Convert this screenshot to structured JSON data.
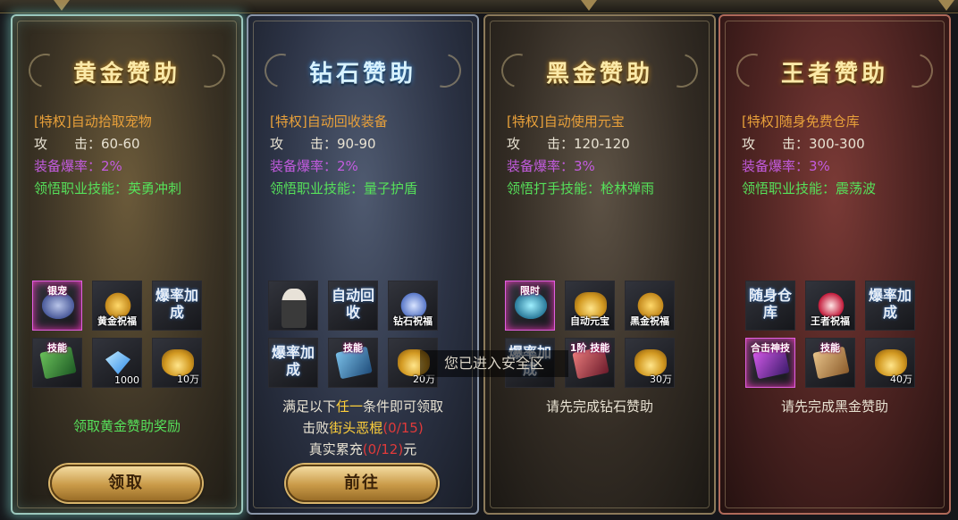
{
  "cards": [
    {
      "title": "黄金赞助",
      "privilege": "[特权]自动拾取宠物",
      "attack": "攻　　击：60-60",
      "drop_rate": "装备爆率：2%",
      "skill": "领悟职业技能：英勇冲刺",
      "rewards": [
        {
          "icon": "pet-icon",
          "label": "银宠"
        },
        {
          "icon": "gold-emblem-icon",
          "label": "黄金祝福"
        },
        {
          "icon": "drop-rate-icon",
          "label": "爆率加成"
        },
        {
          "icon": "skill-book-icon",
          "label": "技能"
        },
        {
          "icon": "diamond-icon",
          "count": "1000"
        },
        {
          "icon": "gold-ingot-icon",
          "count": "10万"
        }
      ],
      "status": "领取黄金赞助奖励",
      "button": "领取"
    },
    {
      "title": "钻石赞助",
      "privilege": "[特权]自动回收装备",
      "attack": "攻　　击：90-90",
      "drop_rate": "装备爆率：2%",
      "skill": "领悟职业技能：量子护盾",
      "rewards": [
        {
          "icon": "officer-avatar-icon",
          "label": ""
        },
        {
          "icon": "auto-recycle-icon",
          "label": "自动回收"
        },
        {
          "icon": "diamond-emblem-icon",
          "label": "钻石祝福"
        },
        {
          "icon": "drop-rate-icon",
          "label": "爆率加成"
        },
        {
          "icon": "skill-book-icon",
          "label": "技能"
        },
        {
          "icon": "gold-ingot-icon",
          "count": "20万"
        }
      ],
      "condition_intro": "满足以下任一条件即可领取",
      "condition_intro_parts": [
        "满足以下",
        "任一",
        "条件即可领取"
      ],
      "condition_1": {
        "prefix": "击败",
        "target": "街头恶棍",
        "progress": "(0/15)"
      },
      "condition_2": {
        "prefix": "真实累充",
        "progress": "(0/12)",
        "suffix": "元"
      },
      "button": "前往"
    },
    {
      "title": "黑金赞助",
      "privilege": "[特权]自动使用元宝",
      "attack": "攻　　击：120-120",
      "drop_rate": "装备爆率：3%",
      "skill": "领悟打手技能：枪林弹雨",
      "rewards": [
        {
          "icon": "weapon-icon",
          "label": "限时"
        },
        {
          "icon": "auto-ingot-icon",
          "label": "自动元宝"
        },
        {
          "icon": "black-gold-emblem-icon",
          "label": "黑金祝福"
        },
        {
          "icon": "drop-rate-icon",
          "label": "爆率加成"
        },
        {
          "icon": "skill-book-icon",
          "label": "1阶 技能"
        },
        {
          "icon": "gold-ingot-icon",
          "count": "30万"
        }
      ],
      "status": "请先完成钻石赞助"
    },
    {
      "title": "王者赞助",
      "privilege": "[特权]随身免费仓库",
      "attack": "攻　　击：300-300",
      "drop_rate": "装备爆率：3%",
      "skill": "领悟职业技能：震荡波",
      "rewards": [
        {
          "icon": "portable-storage-icon",
          "label": "随身仓库"
        },
        {
          "icon": "king-emblem-icon",
          "label": "王者祝福"
        },
        {
          "icon": "drop-rate-icon",
          "label": "爆率加成"
        },
        {
          "icon": "combo-skill-book-icon",
          "label": "合击神技"
        },
        {
          "icon": "skill-book-icon",
          "label": "技能"
        },
        {
          "icon": "gold-ingot-icon",
          "count": "40万"
        }
      ],
      "status": "请先完成黑金赞助"
    }
  ],
  "toast": "您已进入安全区"
}
